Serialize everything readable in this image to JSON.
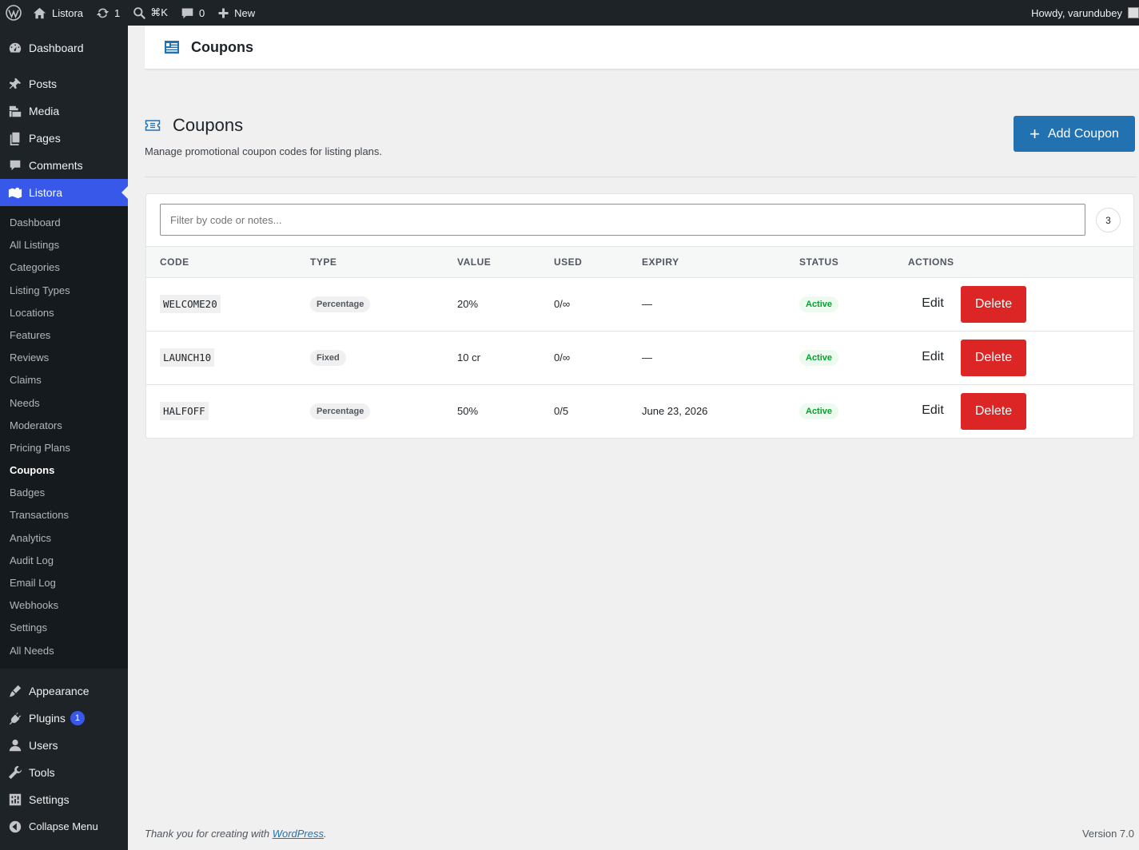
{
  "adminbar": {
    "site": "Listora",
    "updates": "1",
    "search": "⌘K",
    "comments": "0",
    "new": "New",
    "howdy": "Howdy, varundubey"
  },
  "sidebar": {
    "dashboard": "Dashboard",
    "posts": "Posts",
    "media": "Media",
    "pages": "Pages",
    "comments": "Comments",
    "listora": "Listora",
    "submenu": [
      "Dashboard",
      "All Listings",
      "Categories",
      "Listing Types",
      "Locations",
      "Features",
      "Reviews",
      "Claims",
      "Needs",
      "Moderators",
      "Pricing Plans",
      "Coupons",
      "Badges",
      "Transactions",
      "Analytics",
      "Audit Log",
      "Email Log",
      "Webhooks",
      "Settings",
      "All Needs"
    ],
    "appearance": "Appearance",
    "plugins": "Plugins",
    "plugins_count": "1",
    "users": "Users",
    "tools": "Tools",
    "settings": "Settings",
    "collapse": "Collapse Menu"
  },
  "header": {
    "title": "Coupons"
  },
  "page": {
    "title": "Coupons",
    "subtitle": "Manage promotional coupon codes for listing plans.",
    "add_button": "Add Coupon"
  },
  "filter": {
    "placeholder": "Filter by code or notes...",
    "count": "3"
  },
  "table": {
    "headers": [
      "CODE",
      "TYPE",
      "VALUE",
      "USED",
      "EXPIRY",
      "STATUS",
      "ACTIONS"
    ],
    "rows": [
      {
        "code": "WELCOME20",
        "type": "Percentage",
        "value": "20%",
        "used": "0/∞",
        "expiry": "—",
        "status": "Active"
      },
      {
        "code": "LAUNCH10",
        "type": "Fixed",
        "value": "10 cr",
        "used": "0/∞",
        "expiry": "—",
        "status": "Active"
      },
      {
        "code": "HALFOFF",
        "type": "Percentage",
        "value": "50%",
        "used": "0/5",
        "expiry": "June 23, 2026",
        "status": "Active"
      }
    ],
    "edit_label": "Edit",
    "delete_label": "Delete"
  },
  "footer": {
    "thanks_prefix": "Thank you for creating with ",
    "thanks_link": "WordPress",
    "thanks_suffix": ".",
    "version": "Version 7.0"
  },
  "colors": {
    "accent": "#2271b1",
    "menu_current": "#3858e9",
    "danger": "#dc2626",
    "success": "#00a32a"
  }
}
